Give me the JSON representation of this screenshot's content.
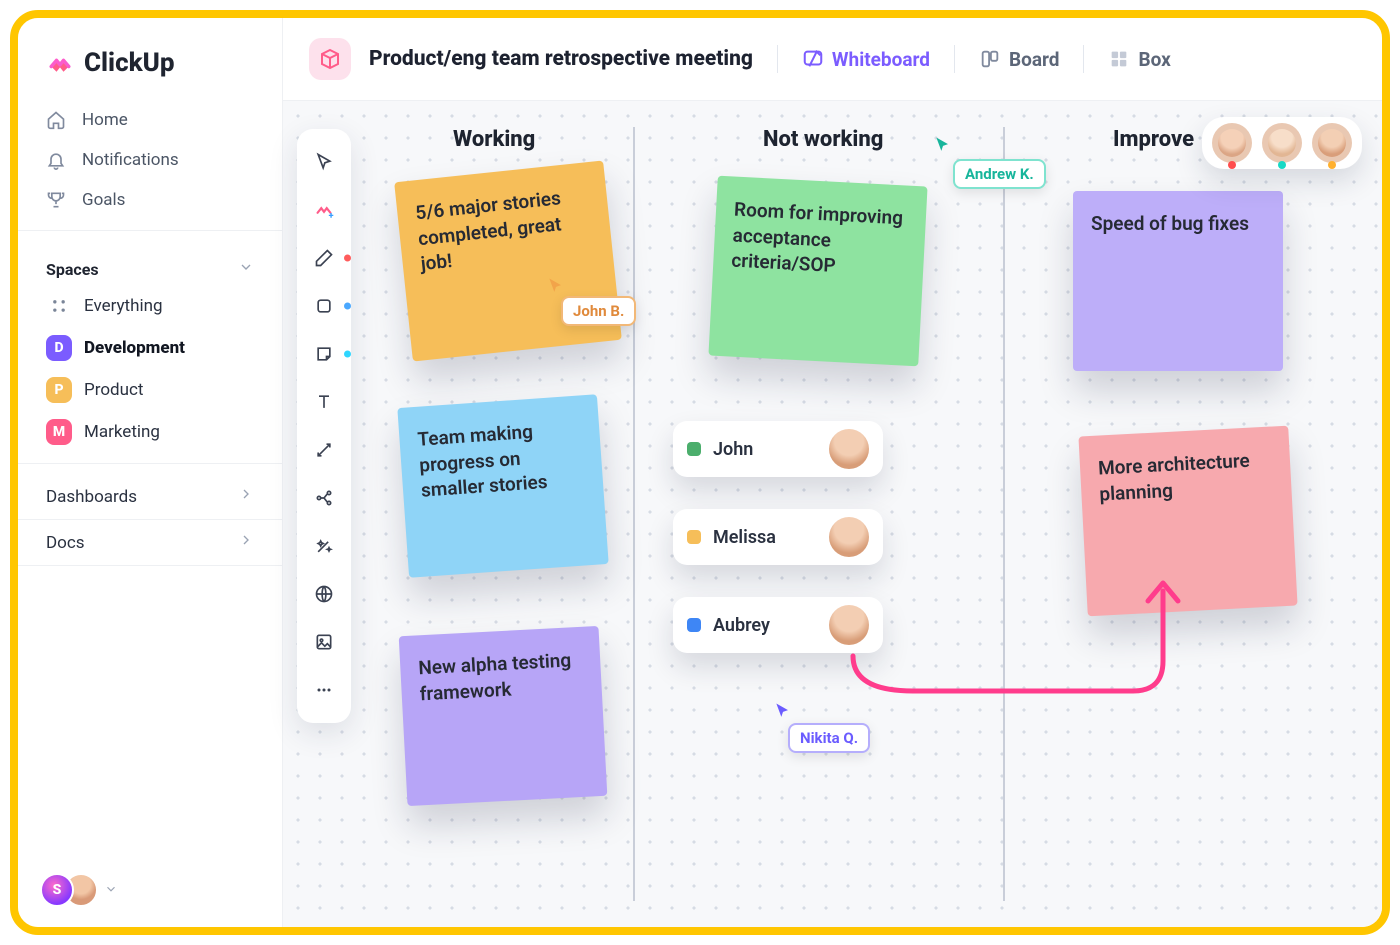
{
  "brand": "ClickUp",
  "nav": {
    "home": "Home",
    "notifications": "Notifications",
    "goals": "Goals"
  },
  "spaces": {
    "header": "Spaces",
    "everything": "Everything",
    "items": [
      {
        "initial": "D",
        "label": "Development",
        "color": "#7B5CFF",
        "active": true
      },
      {
        "initial": "P",
        "label": "Product",
        "color": "#F6BE59",
        "active": false
      },
      {
        "initial": "M",
        "label": "Marketing",
        "color": "#FF5C8A",
        "active": false
      }
    ]
  },
  "sections": {
    "dashboards": "Dashboards",
    "docs": "Docs"
  },
  "header": {
    "title": "Product/eng team retrospective meeting",
    "views": {
      "whiteboard": "Whiteboard",
      "board": "Board",
      "box": "Box"
    }
  },
  "columns": {
    "working": "Working",
    "not_working": "Not working",
    "improve": "Improve"
  },
  "notes": {
    "n1": "5/6 major stories completed, great job!",
    "n2": "Team making progress on smaller stories",
    "n3": "New alpha testing framework",
    "n4": "Room for improving acceptance criteria/SOP",
    "n5": "Speed of bug fixes",
    "n6": "More architecture planning"
  },
  "people": [
    {
      "name": "John",
      "color": "#4BAE6C"
    },
    {
      "name": "Melissa",
      "color": "#F6BE59"
    },
    {
      "name": "Aubrey",
      "color": "#3E86F5"
    }
  ],
  "cursors": {
    "john": "John B.",
    "andrew": "Andrew K.",
    "nikita": "Nikita Q."
  },
  "tools": [
    "select",
    "clickup",
    "draw",
    "shape",
    "note",
    "text",
    "connector",
    "diagram",
    "magic",
    "web",
    "image",
    "more"
  ]
}
